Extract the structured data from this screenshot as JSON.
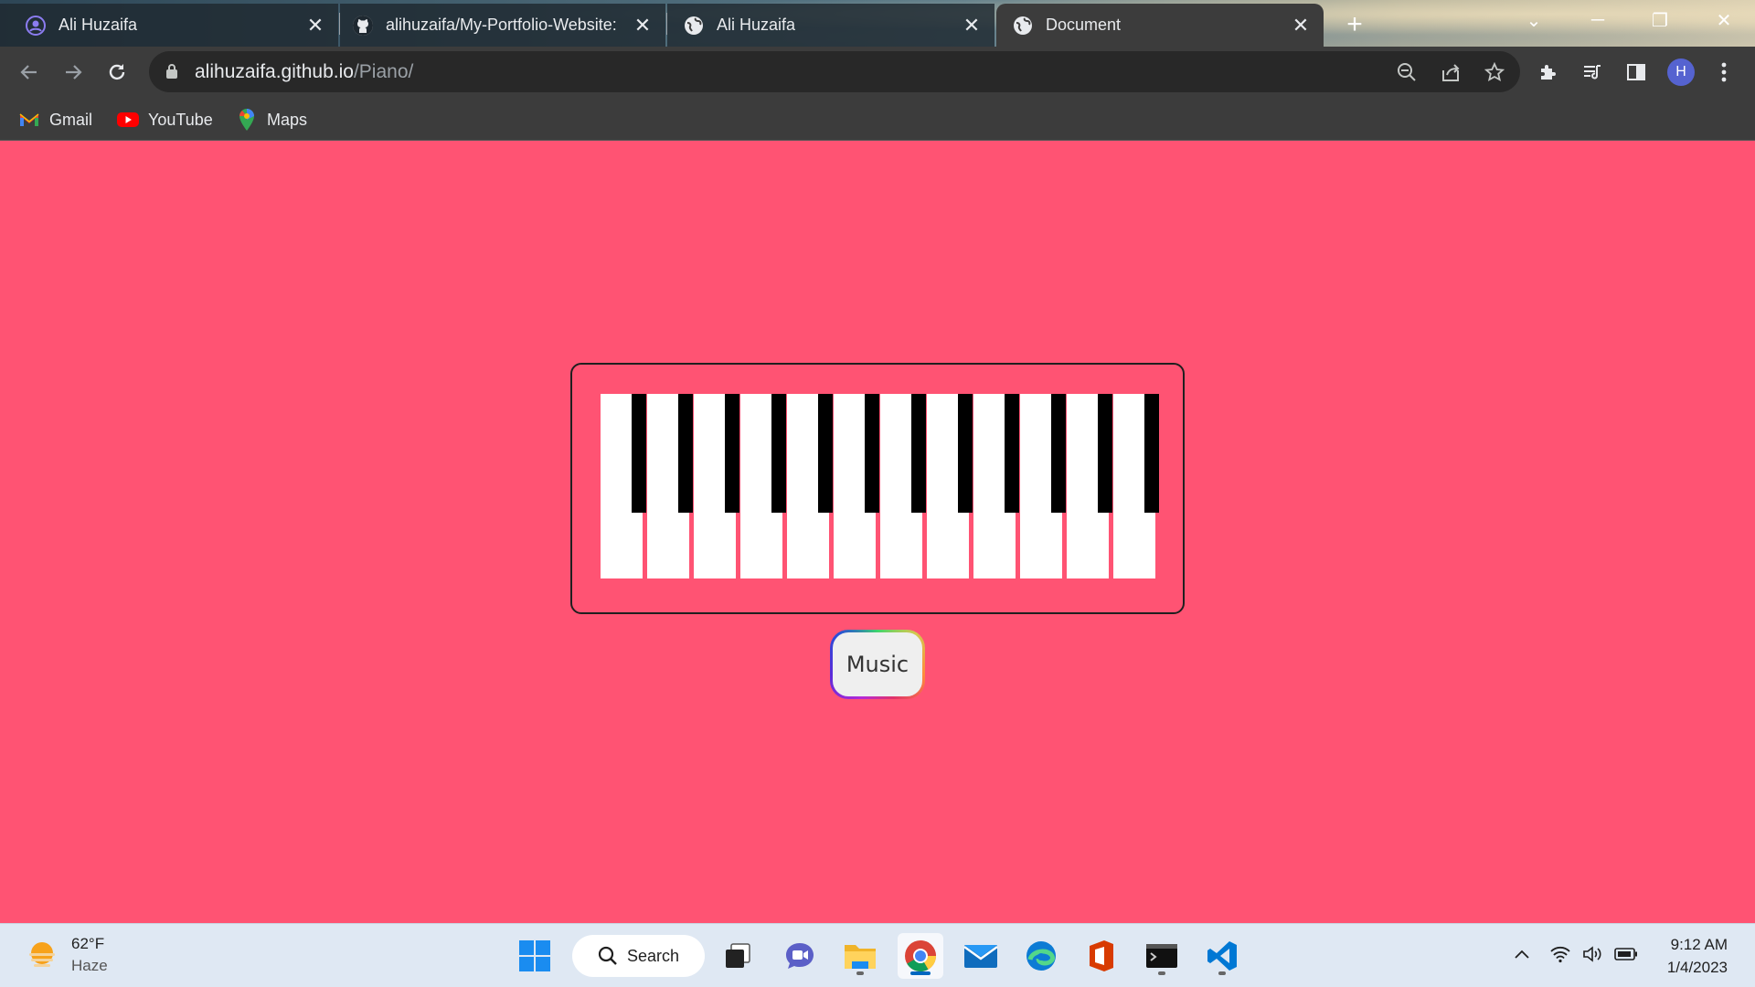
{
  "browser": {
    "tabs": [
      {
        "title": "Ali Huzaifa",
        "favicon": "portfolio-icon",
        "active": false
      },
      {
        "title": "alihuzaifa/My-Portfolio-Website:",
        "favicon": "github-icon",
        "active": false
      },
      {
        "title": "Ali Huzaifa",
        "favicon": "globe-icon",
        "active": false
      },
      {
        "title": "Document",
        "favicon": "globe-icon",
        "active": true
      }
    ],
    "url_host": "alihuzaifa.github.io",
    "url_path": "/Piano/",
    "profile_initial": "H",
    "bookmarks": [
      {
        "label": "Gmail",
        "icon": "gmail-icon"
      },
      {
        "label": "YouTube",
        "icon": "youtube-icon"
      },
      {
        "label": "Maps",
        "icon": "maps-icon"
      }
    ]
  },
  "page": {
    "background_color": "#ff5373",
    "piano": {
      "white_keys": 12,
      "black_keys": 12
    },
    "music_button_label": "Music"
  },
  "taskbar": {
    "weather_temp": "62°F",
    "weather_desc": "Haze",
    "search_label": "Search",
    "time": "9:12 AM",
    "date": "1/4/2023"
  }
}
